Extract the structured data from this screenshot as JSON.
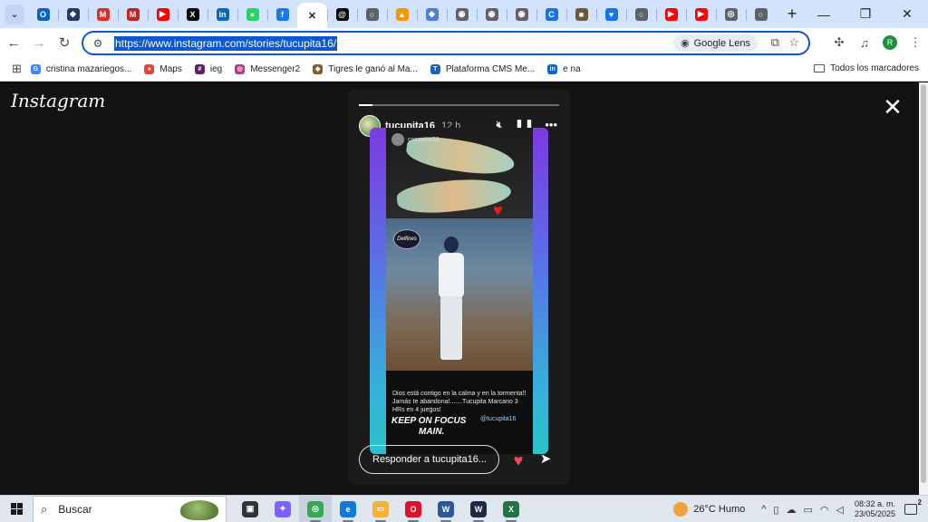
{
  "browser": {
    "tabs": [
      {
        "icon": "outlook-icon",
        "color": "#0a64c8",
        "glyph": "O"
      },
      {
        "icon": "shield-icon",
        "color": "#1d3c6b",
        "glyph": "◆"
      },
      {
        "icon": "gmail-icon",
        "color": "#d93025",
        "glyph": "M"
      },
      {
        "icon": "gmail-icon",
        "color": "#c5221f",
        "glyph": "M"
      },
      {
        "icon": "youtube-icon",
        "color": "#ff0000",
        "glyph": "▶"
      },
      {
        "icon": "x-icon",
        "color": "#000000",
        "glyph": "X"
      },
      {
        "icon": "linkedin-icon",
        "color": "#0a66c2",
        "glyph": "in"
      },
      {
        "icon": "whatsapp-icon",
        "color": "#25d366",
        "glyph": "●"
      },
      {
        "icon": "facebook-icon",
        "color": "#1877f2",
        "glyph": "f"
      },
      {
        "icon": "instagram-icon",
        "color": "#ffffff",
        "glyph": "✕",
        "active": true
      },
      {
        "icon": "threads-icon",
        "color": "#000000",
        "glyph": "@"
      },
      {
        "icon": "site-icon",
        "color": "#5f6368",
        "glyph": "○"
      },
      {
        "icon": "chart-icon",
        "color": "#f29900",
        "glyph": "▲"
      },
      {
        "icon": "cube-icon",
        "color": "#4f7fd1",
        "glyph": "◆"
      },
      {
        "icon": "globe-icon",
        "color": "#5f6368",
        "glyph": "◉"
      },
      {
        "icon": "globe-icon",
        "color": "#5f6368",
        "glyph": "◉"
      },
      {
        "icon": "globe-icon",
        "color": "#5f6368",
        "glyph": "◉"
      },
      {
        "icon": "c-icon",
        "color": "#1a73e8",
        "glyph": "C"
      },
      {
        "icon": "badge-icon",
        "color": "#6b5a3a",
        "glyph": "■"
      },
      {
        "icon": "heart-icon",
        "color": "#1a73e8",
        "glyph": "♥"
      },
      {
        "icon": "site-icon",
        "color": "#5f6368",
        "glyph": "○"
      },
      {
        "icon": "youtube-icon",
        "color": "#ff0000",
        "glyph": "▶"
      },
      {
        "icon": "youtube-icon",
        "color": "#ff0000",
        "glyph": "▶"
      },
      {
        "icon": "chrome-icon",
        "color": "#5f6368",
        "glyph": "◎"
      },
      {
        "icon": "site-icon",
        "color": "#5f6368",
        "glyph": "○"
      }
    ],
    "address": {
      "url": "https://www.instagram.com/stories/tucupita16/",
      "lens_label": "Google Lens"
    },
    "profile_initial": "R",
    "bookmarks": [
      {
        "icon": "google-icon",
        "color": "#4285f4",
        "glyph": "G",
        "label": "cristina mazariegos..."
      },
      {
        "icon": "maps-icon",
        "color": "#ea4335",
        "glyph": "●",
        "label": "Maps"
      },
      {
        "icon": "slack-icon",
        "color": "#611f69",
        "glyph": "#",
        "label": "ieg"
      },
      {
        "icon": "instagram-icon",
        "color": "#c13584",
        "glyph": "◎",
        "label": "Messenger2"
      },
      {
        "icon": "pin-icon",
        "color": "#8a5a2b",
        "glyph": "◆",
        "label": "Tigres le ganó al Ma..."
      },
      {
        "icon": "tfs-icon",
        "color": "#1565c0",
        "glyph": "T",
        "label": "Plataforma CMS Me..."
      },
      {
        "icon": "linkedin-icon",
        "color": "#0a66c2",
        "glyph": "in",
        "label": "e na"
      }
    ],
    "all_bookmarks_label": "Todos los marcadores"
  },
  "instagram": {
    "logo": "Instagram",
    "story": {
      "username": "tucupita16",
      "time": "12 h",
      "progress": 0.07,
      "repost_user": "cocorote33",
      "caption": "Dios está contigo en la calma y en la tormenta!! Jamás te abandona!.......Tucupita Marcano 3 HRs en 4 juegos!",
      "focus_line1": "KEEP ON FOCUS",
      "focus_line2": "MAIN.",
      "handle": "@tucupita16",
      "team_logo": "Delfines",
      "reply_placeholder": "Responder a tucupita16..."
    }
  },
  "taskbar": {
    "search_placeholder": "Buscar",
    "apps": [
      {
        "icon": "task-view-icon",
        "color": "#333333",
        "glyph": "▣"
      },
      {
        "icon": "copilot-icon",
        "color": "#7b61ff",
        "glyph": "✦"
      },
      {
        "icon": "chrome-icon",
        "color": "#34a853",
        "glyph": "◎",
        "active": true
      },
      {
        "icon": "edge-icon",
        "color": "#0f7bd6",
        "glyph": "e"
      },
      {
        "icon": "file-explorer-icon",
        "color": "#f2b233",
        "glyph": "▭"
      },
      {
        "icon": "opera-icon",
        "color": "#e0112b",
        "glyph": "O"
      },
      {
        "icon": "word-icon",
        "color": "#2b579a",
        "glyph": "W"
      },
      {
        "icon": "app-icon",
        "color": "#1f2a44",
        "glyph": "W"
      },
      {
        "icon": "excel-icon",
        "color": "#217346",
        "glyph": "X"
      }
    ],
    "weather": "26°C  Humo",
    "time": "08:32 a. m.",
    "date": "23/05/2025",
    "notification_count": "2"
  }
}
